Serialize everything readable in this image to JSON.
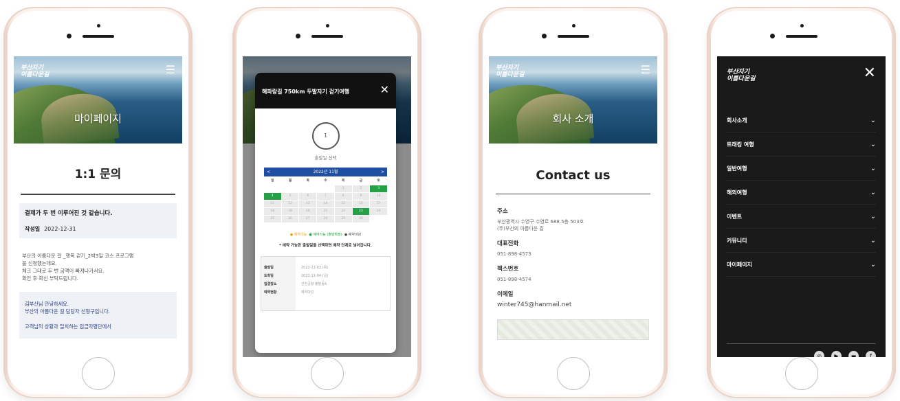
{
  "phone1": {
    "hero": {
      "logo_line1": "부산자기",
      "logo_line2": "이름다운길",
      "title": "마이페이지"
    },
    "heading": "1:1 문의",
    "card": {
      "question": "결제가 두 번 이루어진 것 같습니다.",
      "date_label": "작성일",
      "date": "2022-12-31"
    },
    "body": [
      "부산의 아름다운 길 _행복 걷기_2박3일 코스 프로그램",
      "을 신청했는데요.",
      "체크 그대로 두 번 금액이 빠져나가서요.",
      "확인 후 회신 부탁드립니다."
    ],
    "answer": [
      "김부산님 안녕하세요.",
      "부산의 아름다운 길 담당자 신형구입니다.",
      "",
      "고객님의 상황과 일치하는 입금자명단에서"
    ]
  },
  "phone2": {
    "modal_title": "해파랑길 750km 두발자기 걷기여행",
    "step_number": "1",
    "step_label": "출발일 선택",
    "calendar": {
      "month": "2022년 11월",
      "weekdays": [
        "일",
        "월",
        "화",
        "수",
        "목",
        "금",
        "토"
      ],
      "cells": [
        "",
        "",
        "",
        "",
        "1",
        "2",
        "3",
        "4",
        "5",
        "6",
        "7",
        "8",
        "9",
        "10",
        "11",
        "12",
        "13",
        "14",
        "15",
        "16",
        "17",
        "18",
        "19",
        "20",
        "21",
        "22",
        "23",
        "24",
        "25",
        "26",
        "27",
        "28",
        "29",
        "30",
        ""
      ],
      "green_days": [
        "3",
        "4",
        "23"
      ]
    },
    "legend": [
      "● 예약가능",
      "● 예약가능 (출발확정)",
      "● 예약마감"
    ],
    "note": "* 예약 가능한 출발일을 선택하면 예약 단계로 넘어갑니다.",
    "info_keys": [
      "출발일",
      "도착일",
      "집결장소",
      "예약현황"
    ],
    "info_values": [
      "2022-11-03 (목)",
      "2022-11-04 (금)",
      "인천공항 출발홀A",
      "예약마감"
    ]
  },
  "phone3": {
    "hero": {
      "logo_line1": "부산자기",
      "logo_line2": "이름다운길",
      "title": "회사 소개"
    },
    "heading": "Contact us",
    "address_label": "주소",
    "address": [
      "부산광역시 수영구 수영로 688.5층 503호",
      "(주)부산의 아름다운 길"
    ],
    "phone_label": "대표전화",
    "phone": "051-898-4573",
    "fax_label": "팩스번호",
    "fax": "051-898-4574",
    "email_label": "이메일",
    "email": "winter745@hanmail.net"
  },
  "phone4": {
    "logo_line1": "부산자기",
    "logo_line2": "이름다운길",
    "nav": [
      "회사소개",
      "트래킹 여행",
      "일반여행",
      "해외여행",
      "이벤트",
      "커뮤니티",
      "마이페이지"
    ]
  }
}
